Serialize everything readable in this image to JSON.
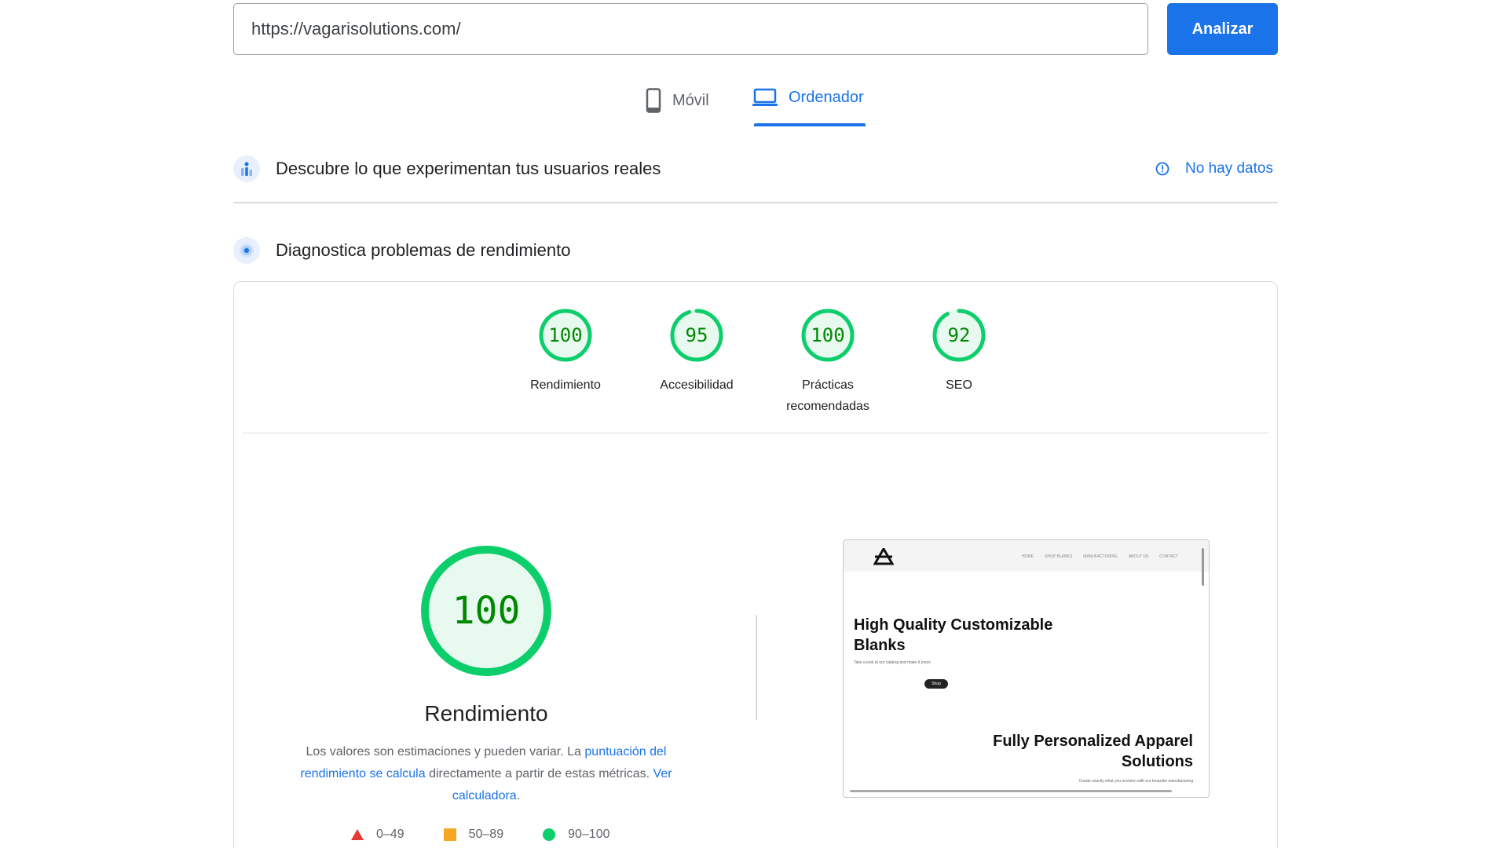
{
  "url_bar": {
    "value": "https://vagarisolutions.com/",
    "button": "Analizar"
  },
  "tabs": [
    {
      "label": "Móvil",
      "icon": "smartphone-icon",
      "active": false
    },
    {
      "label": "Ordenador",
      "icon": "laptop-icon",
      "active": true
    }
  ],
  "field_data": {
    "title": "Descubre lo que experimentan tus usuarios reales",
    "no_data": "No hay datos"
  },
  "lab_data": {
    "title": "Diagnostica problemas de rendimiento"
  },
  "scores": [
    {
      "value": "100",
      "label": "Rendimiento",
      "fraction": 1.0
    },
    {
      "value": "95",
      "label": "Accesibilidad",
      "fraction": 0.95
    },
    {
      "value": "100",
      "label": "Prácticas recomendadas",
      "fraction": 1.0
    },
    {
      "value": "92",
      "label": "SEO",
      "fraction": 0.92
    }
  ],
  "performance": {
    "score": "100",
    "title": "Rendimiento",
    "desc_1": "Los valores son estimaciones y pueden variar. La ",
    "link_1": "puntuación del rendimiento se calcula",
    "desc_2": " directamente a partir de estas métricas. ",
    "link_2": "Ver calculadora",
    "desc_3": "."
  },
  "legend": [
    {
      "range": "0–49",
      "shape": "triangle",
      "color": "#e53935"
    },
    {
      "range": "50–89",
      "shape": "square",
      "color": "#f6a623"
    },
    {
      "range": "90–100",
      "shape": "circle",
      "color": "#0cce6b"
    }
  ],
  "colors": {
    "accent": "#1a73e8",
    "pass": "#0cce6b",
    "pass_text": "#008800",
    "pass_fill": "#e8faf0"
  },
  "thumbnail": {
    "nav_links": [
      "HOME",
      "SHOP BLANKS",
      "MANUFACTURING",
      "ABOUT US",
      "CONTACT"
    ],
    "heading_1": "High Quality Customizable Blanks",
    "sub_1": "Take a look at our catalog and make it yours",
    "button": "Shop",
    "heading_2": "Fully Personalized Apparel Solutions",
    "sub_2": "Create exactly what you envision with our bespoke manufacturing"
  }
}
